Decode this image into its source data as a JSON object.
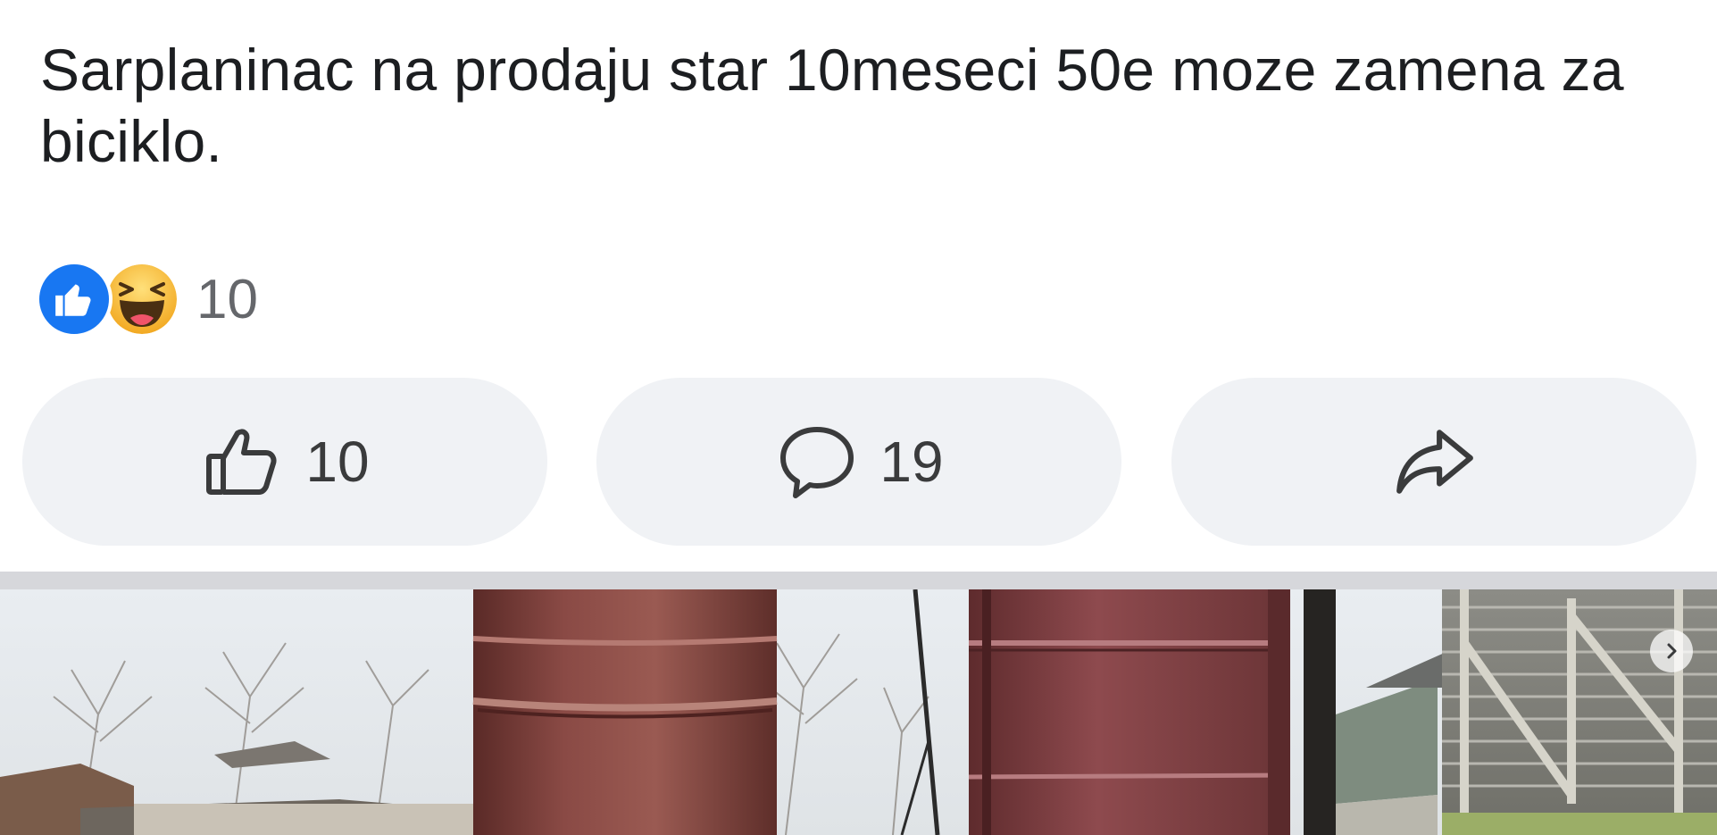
{
  "post": {
    "text": "Sarplaninac na prodaju star 10meseci 50e moze zamena za biciklo."
  },
  "reactions": {
    "icons": [
      "like-icon",
      "haha-icon"
    ],
    "count": "10"
  },
  "actions": {
    "like_count": "10",
    "comment_count": "19",
    "share_icon": "share-arrow-icon"
  },
  "colors": {
    "like_blue": "#1877f2",
    "haha_yellow": "#f7c23a",
    "button_bg": "#f0f2f5",
    "divider": "#d6d7db"
  },
  "photo": {
    "icon": "next-arrow-icon"
  }
}
